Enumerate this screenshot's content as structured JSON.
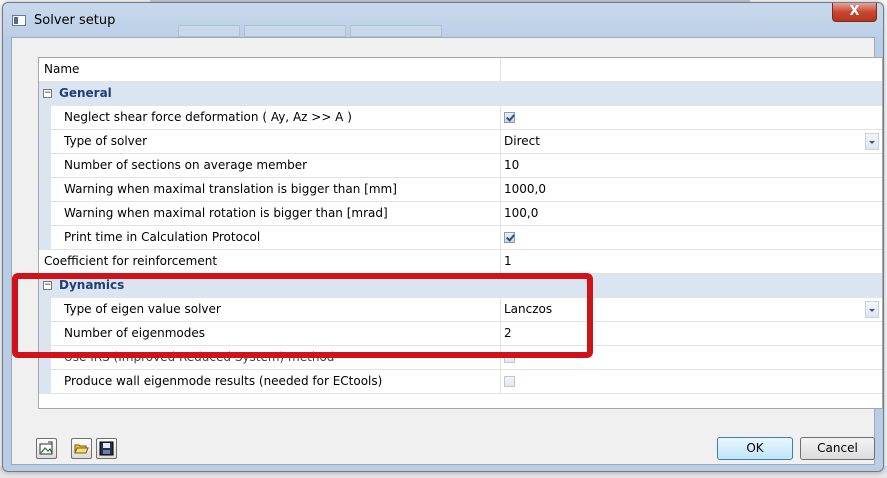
{
  "window": {
    "title": "Solver setup",
    "close_label": "X"
  },
  "grid": {
    "header": {
      "name": "Name",
      "value": ""
    },
    "sections": {
      "general": {
        "label": "General",
        "expander": "−",
        "neglect_shear": {
          "label": "Neglect shear force deformation ( Ay, Az >> A )",
          "checked": true
        },
        "solver_type": {
          "label": "Type of solver",
          "value": "Direct"
        },
        "sections_count": {
          "label": "Number of sections on average member",
          "value": "10"
        },
        "warn_translation": {
          "label": "Warning when maximal translation is bigger than [mm]",
          "value": "1000,0"
        },
        "warn_rotation": {
          "label": "Warning when maximal rotation is bigger than [mrad]",
          "value": "100,0"
        },
        "print_time": {
          "label": "Print time in Calculation Protocol",
          "checked": true
        }
      },
      "coef_reinforcement": {
        "label": "Coefficient for reinforcement",
        "value": "1"
      },
      "dynamics": {
        "label": "Dynamics",
        "expander": "−",
        "eigen_solver": {
          "label": "Type of eigen value solver",
          "value": "Lanczos"
        },
        "eigenmodes": {
          "label": "Number of eigenmodes",
          "value": "2"
        },
        "irs": {
          "label": "Use IRS (Improved Reduced System) method",
          "checked": false
        },
        "wall_modes": {
          "label": "Produce wall eigenmode results (needed for ECtools)",
          "checked": false
        }
      }
    }
  },
  "buttons": {
    "ok": "OK",
    "cancel": "Cancel"
  },
  "colors": {
    "highlight": "#d0131b",
    "category_bg": "#dbe5f1",
    "category_text": "#1f3f7a"
  }
}
